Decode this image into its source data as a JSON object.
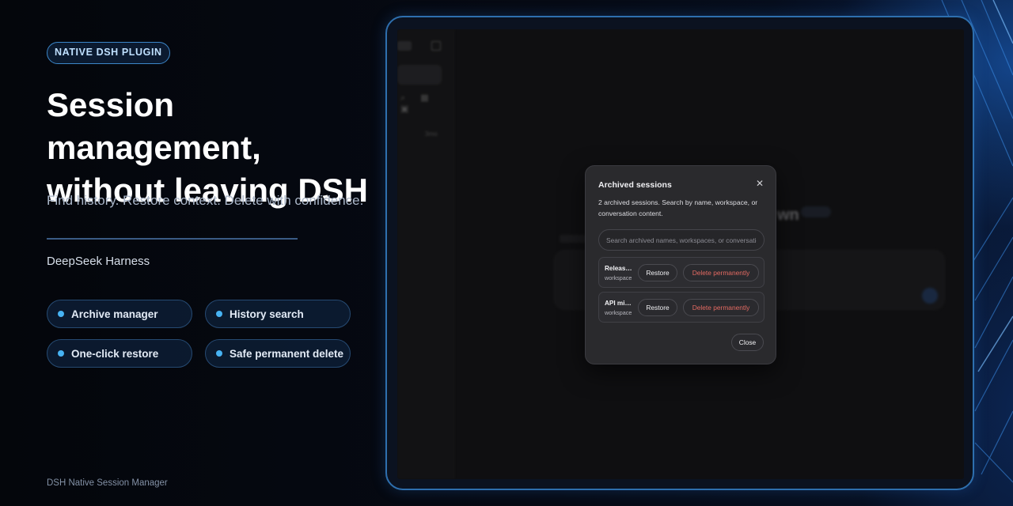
{
  "hero": {
    "badge": "NATIVE DSH PLUGIN",
    "title_line1": "Session management,",
    "title_line2": "without leaving DSH",
    "tagline": "Find history. Restore context. Delete with confidence.",
    "brand": "DeepSeek Harness",
    "footer": "DSH Native Session Manager"
  },
  "features": [
    {
      "label": "Archive manager"
    },
    {
      "label": "History search"
    },
    {
      "label": "One-click restore"
    },
    {
      "label": "Safe permanent delete"
    }
  ],
  "background_app": {
    "title_fragment": "wn",
    "chip": "Preview",
    "sidebar_time": "3mo"
  },
  "modal": {
    "title": "Archived sessions",
    "description": "2 archived sessions. Search by name, workspace, or conversation content.",
    "search_placeholder": "Search archived names, workspaces, or conversation content",
    "sessions": [
      {
        "name": "Releas…",
        "workspace": "workspace",
        "restore_label": "Restore",
        "delete_label": "Delete permanently"
      },
      {
        "name": "API mi…",
        "workspace": "workspace",
        "restore_label": "Restore",
        "delete_label": "Delete permanently"
      }
    ],
    "close_label": "Close"
  },
  "colors": {
    "accent": "#47b3f3",
    "danger": "#e36a62",
    "frame": "#2e6fae"
  }
}
